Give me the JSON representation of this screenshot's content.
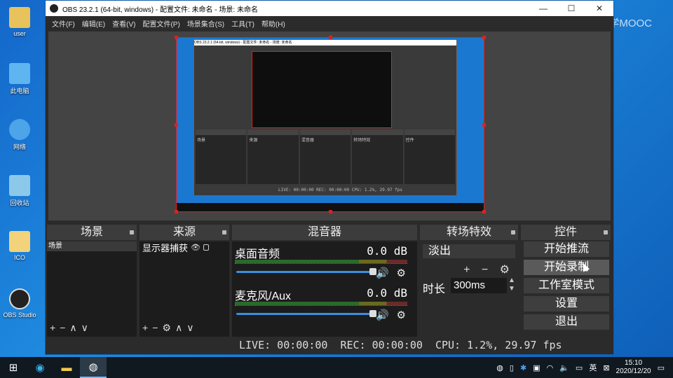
{
  "desktop": {
    "icons": [
      {
        "label": "user",
        "color": "#e8c25a"
      },
      {
        "label": "此电脑",
        "color": "#5fb5f0"
      },
      {
        "label": "网络",
        "color": "#4ea4e8"
      },
      {
        "label": "回收站",
        "color": "#8cc8ea"
      },
      {
        "label": "ICO",
        "color": "#f2d27a"
      },
      {
        "label": "OBS Studio",
        "color": "#222222"
      }
    ],
    "watermark": "中国大学MOOC"
  },
  "window": {
    "title": "OBS 23.2.1 (64-bit, windows) - 配置文件: 未命名 - 场景: 未命名",
    "buttons": {
      "minimize": "—",
      "maximize": "☐",
      "close": "✕"
    }
  },
  "menu": [
    "文件(F)",
    "编辑(E)",
    "查看(V)",
    "配置文件(P)",
    "场景集合(S)",
    "工具(T)",
    "帮助(H)"
  ],
  "preview": {
    "inner_title": "OBS 23.2.1 (64-bit, windows) - 配置文件: 未命名 - 场景: 未命名",
    "inner_docks": [
      "场景",
      "来源",
      "混音器",
      "转场特效",
      "控件"
    ],
    "inner_status": "LIVE: 00:00:00  REC: 00:00:00  CPU: 1.2%, 29.97 fps"
  },
  "docks": {
    "scenes": {
      "title": "场景",
      "items": [
        "场景"
      ],
      "tools": [
        "+",
        "−",
        "∧",
        "∨"
      ]
    },
    "sources": {
      "title": "来源",
      "items": [
        "显示器捕获"
      ],
      "tools": [
        "+",
        "−",
        "⚙",
        "∧",
        "∨"
      ]
    },
    "mixer": {
      "title": "混音器",
      "tracks": [
        {
          "name": "桌面音频",
          "db": "0.0 dB"
        },
        {
          "name": "麦克风/Aux",
          "db": "0.0 dB"
        }
      ]
    },
    "transitions": {
      "title": "转场特效",
      "selected": "淡出",
      "duration_label": "时长",
      "duration": "300ms",
      "tools": "+ − ⚙"
    },
    "controls": {
      "title": "控件",
      "buttons": [
        "开始推流",
        "开始录制",
        "工作室模式",
        "设置",
        "退出"
      ]
    }
  },
  "status": {
    "live": "LIVE: 00:00:00",
    "rec": "REC: 00:00:00",
    "cpu": "CPU: 1.2%, 29.97 fps"
  },
  "taskbar": {
    "ime": "英",
    "time": "15:10",
    "date": "2020/12/20"
  }
}
